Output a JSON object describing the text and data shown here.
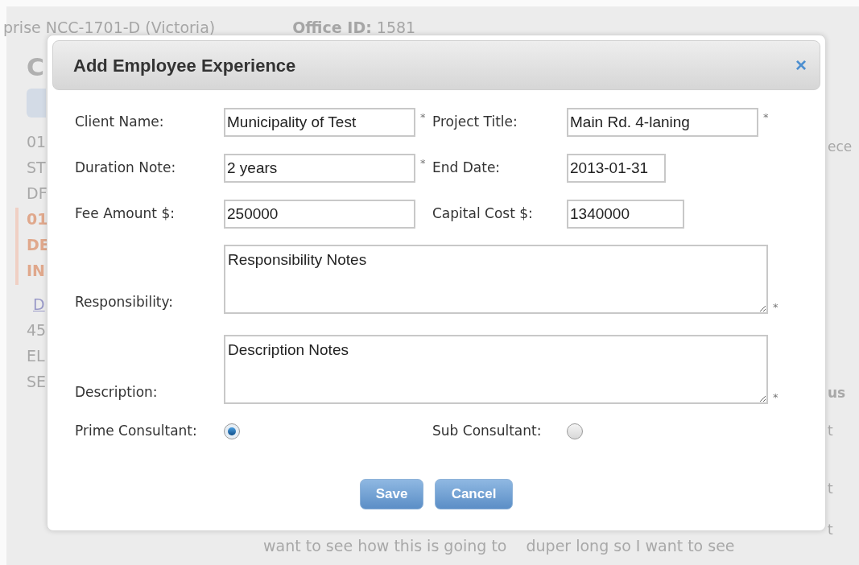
{
  "background": {
    "header": [
      {
        "kind": "plain",
        "text": "prise NCC-1701-D (Victoria)"
      },
      {
        "kind": "plain",
        "text": "**Office ID:** 1581"
      }
    ],
    "left_column": [
      {
        "kind": "heading",
        "text": "C"
      },
      {
        "kind": "button"
      },
      {
        "kind": "plain",
        "text": "01"
      },
      {
        "kind": "plain",
        "text": "ST"
      },
      {
        "kind": "plain",
        "text": "DF"
      },
      {
        "kind": "highlight",
        "text": "01"
      },
      {
        "kind": "highlight",
        "text": "DE"
      },
      {
        "kind": "highlight",
        "text": "IN"
      },
      {
        "kind": "link",
        "text": "D"
      },
      {
        "kind": "plain",
        "text": "45"
      },
      {
        "kind": "plain",
        "text": "EL"
      },
      {
        "kind": "plain",
        "text": "SE"
      }
    ],
    "right_column": [
      {
        "kind": "plain",
        "text": "ece"
      },
      {
        "kind": "header",
        "text": "us"
      },
      {
        "kind": "plain",
        "text": "t"
      },
      {
        "kind": "plain",
        "text": "t"
      },
      {
        "kind": "plain",
        "text": "t"
      }
    ],
    "bottom_text": [
      "want to see how this is going to",
      "duper long so I want to see"
    ]
  },
  "dialog": {
    "title": "Add Employee Experience",
    "close": "×",
    "fields": [
      {
        "kind": "text",
        "label": "Client Name:",
        "value": "Municipality of Test",
        "required": true
      },
      {
        "kind": "text",
        "label": "Project Title:",
        "value": "Main Rd. 4-laning",
        "required": true
      },
      {
        "kind": "text",
        "label": "Duration Note:",
        "value": "2 years",
        "required": true
      },
      {
        "kind": "text",
        "label": "End Date:",
        "value": "2013-01-31",
        "required": false
      },
      {
        "kind": "text",
        "label": "Fee Amount $:",
        "value": "250000",
        "required": false
      },
      {
        "kind": "text",
        "label": "Capital Cost $:",
        "value": "1340000",
        "required": false
      },
      {
        "kind": "textarea",
        "label": "Responsibility:",
        "value": "Responsibility Notes",
        "required": true
      },
      {
        "kind": "textarea",
        "label": "Description:",
        "value": "Description Notes",
        "required": true
      }
    ],
    "radios": [
      {
        "label": "Prime Consultant:",
        "selected": true
      },
      {
        "label": "Sub Consultant:",
        "selected": false
      }
    ],
    "star": "*",
    "buttons": [
      "Save",
      "Cancel"
    ]
  }
}
